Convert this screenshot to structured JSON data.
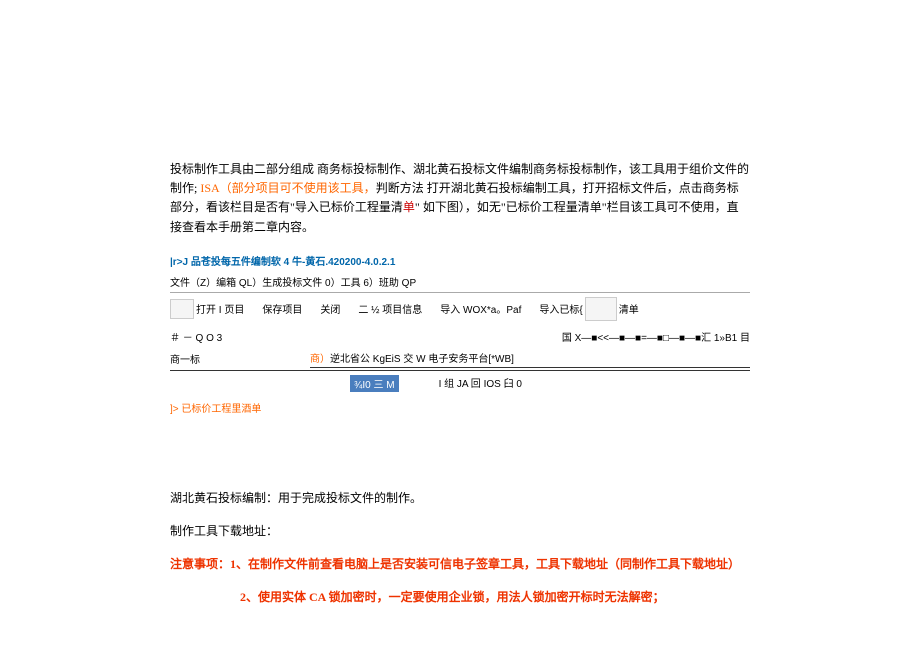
{
  "para1": {
    "t1": "投标制作工具由二部分组成 商务标投标制作、湖北黄石投标文件编制商务标投标制作，该工具用于组价文件的制作; ",
    "t2": "ISA（部分项目可不使用该工具，",
    "t3": "判断方法 打开湖北黄石投标编制工具，打开招标文件后，点击商务标部分，看该栏目是否有\"导入已标价工程量清",
    "t4": "单",
    "t5": "\" 如下图），如无\"已标价工程量清单\"栏目该工具可不使用，直接查看本手册第二章内容。"
  },
  "app": {
    "title": "|r>J 品苍投每五件编制软 4 牛-黄石.420200-4.0.2.1",
    "menubar": "文件（Z）编箱 QL）生成投标文件 0）工具 6）班助 QP",
    "toolbar": {
      "open": "打开 I 页目",
      "save": "保存项目",
      "close": "关闭",
      "proj": "二 ½\n项目信息",
      "import1": "导入 WOX*a。Paf",
      "import2": "导入已标{",
      "list": "清单"
    },
    "row3": {
      "left": "＃ － Q O 3",
      "right": "国 X—■<<—■—■=—■□—■—■汇 1»B1 目"
    },
    "row4": {
      "left": "商一标",
      "mid_red": "商）",
      "mid": "逆北省公 KgEiS 交 W 电子安务平台[*WB]"
    },
    "row5": {
      "a": "¾I0 三 M",
      "b": "I 组 JA 回 IOS 臼 0"
    },
    "footer": "]> 已标价工程里酒单"
  },
  "bottom": {
    "l1": "湖北黄石投标编制：用于完成投标文件的制作。",
    "l2": "制作工具下载地址：",
    "l3": "注意事项：1、在制作文件前查看电脑上是否安装可信电子签章工具，工具下载地址（同制作工具下载地址）",
    "l4": "2、使用实体 CA 锁加密时，一定要使用企业锁，用法人锁加密开标时无法解密；"
  }
}
